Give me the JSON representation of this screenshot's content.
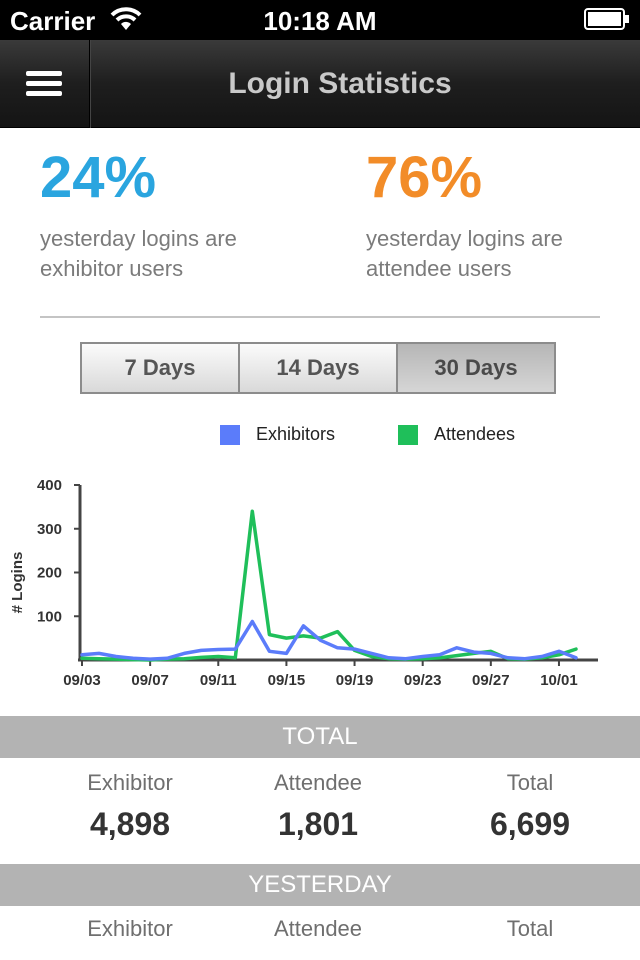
{
  "status_bar": {
    "carrier": "Carrier",
    "time": "10:18 AM"
  },
  "nav": {
    "title": "Login Statistics",
    "menu_icon": "hamburger-menu-icon"
  },
  "stats": {
    "exhibitor_pct": "24%",
    "exhibitor_desc_line1": "yesterday logins are",
    "exhibitor_desc_line2": "exhibitor users",
    "attendee_pct": "76%",
    "attendee_desc_line1": "yesterday logins are",
    "attendee_desc_line2": "attendee users"
  },
  "range_tabs": [
    {
      "label": "7 Days",
      "active": false
    },
    {
      "label": "14 Days",
      "active": false
    },
    {
      "label": "30 Days",
      "active": true
    }
  ],
  "colors": {
    "exhibitors": "#5b7cfa",
    "attendees": "#1fbf5a",
    "exhibitor_pct": "#2aa5df",
    "attendee_pct": "#f28c28"
  },
  "chart_data": {
    "type": "line",
    "ylabel": "# Logins",
    "ylim": [
      0,
      400
    ],
    "yticks": [
      100,
      200,
      300,
      400
    ],
    "x_tick_labels": [
      "09/03",
      "09/07",
      "09/11",
      "09/15",
      "09/19",
      "09/23",
      "09/27",
      "10/01"
    ],
    "x": [
      "09/03",
      "09/04",
      "09/05",
      "09/06",
      "09/07",
      "09/08",
      "09/09",
      "09/10",
      "09/11",
      "09/12",
      "09/13",
      "09/14",
      "09/15",
      "09/16",
      "09/17",
      "09/18",
      "09/19",
      "09/20",
      "09/21",
      "09/22",
      "09/23",
      "09/24",
      "09/25",
      "09/26",
      "09/27",
      "09/28",
      "09/29",
      "09/30",
      "10/01",
      "10/02"
    ],
    "legend_position": "top",
    "series": [
      {
        "name": "Exhibitors",
        "values": [
          12,
          15,
          8,
          4,
          2,
          4,
          15,
          22,
          24,
          25,
          88,
          20,
          15,
          78,
          45,
          28,
          25,
          15,
          5,
          3,
          8,
          12,
          28,
          18,
          15,
          5,
          3,
          8,
          20,
          5
        ]
      },
      {
        "name": "Attendees",
        "values": [
          4,
          3,
          2,
          1,
          0,
          2,
          3,
          6,
          8,
          5,
          340,
          58,
          50,
          55,
          50,
          65,
          22,
          8,
          3,
          2,
          3,
          5,
          10,
          15,
          20,
          3,
          2,
          5,
          12,
          25
        ]
      }
    ]
  },
  "totals": {
    "header": "TOTAL",
    "exhibitor_label": "Exhibitor",
    "exhibitor_value": "4,898",
    "attendee_label": "Attendee",
    "attendee_value": "1,801",
    "total_label": "Total",
    "total_value": "6,699"
  },
  "yesterday": {
    "header": "YESTERDAY",
    "exhibitor_label": "Exhibitor",
    "attendee_label": "Attendee",
    "total_label": "Total"
  }
}
